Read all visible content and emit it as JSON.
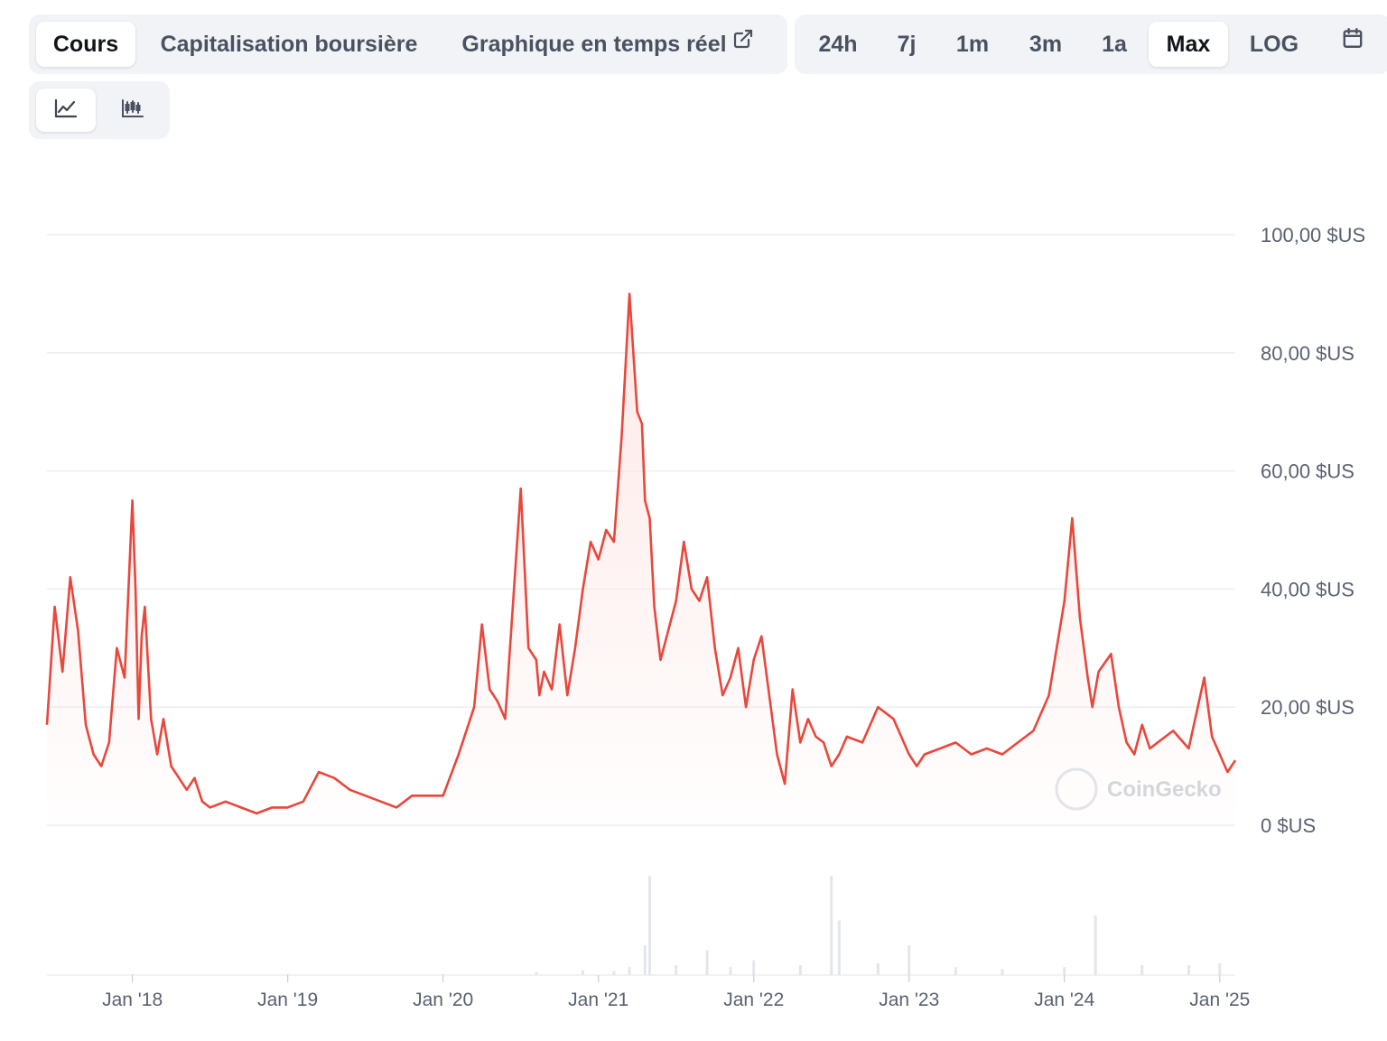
{
  "tabs": [
    {
      "label": "Cours",
      "active": true
    },
    {
      "label": "Capitalisation boursière",
      "active": false
    },
    {
      "label": "Graphique en temps réel",
      "active": false,
      "icon": "external-link-icon"
    }
  ],
  "ranges": [
    {
      "label": "24h",
      "active": false
    },
    {
      "label": "7j",
      "active": false
    },
    {
      "label": "1m",
      "active": false
    },
    {
      "label": "3m",
      "active": false
    },
    {
      "label": "1a",
      "active": false
    },
    {
      "label": "Max",
      "active": true
    },
    {
      "label": "LOG",
      "active": false
    }
  ],
  "calendar_icon": "calendar-icon",
  "chart_types": [
    {
      "icon": "line-chart-icon",
      "active": true
    },
    {
      "icon": "candlestick-chart-icon",
      "active": false
    }
  ],
  "watermark": "CoinGecko",
  "colors": {
    "line": "#e8473c",
    "fill": "#fde6e4",
    "grid": "#e9ebee",
    "volume": "#e3e6ea"
  },
  "chart_data": {
    "type": "area",
    "x_unit": "year",
    "x": [
      2017.45,
      2017.5,
      2017.55,
      2017.6,
      2017.65,
      2017.7,
      2017.75,
      2017.8,
      2017.85,
      2017.9,
      2017.95,
      2018.0,
      2018.02,
      2018.04,
      2018.06,
      2018.08,
      2018.12,
      2018.16,
      2018.2,
      2018.25,
      2018.3,
      2018.35,
      2018.4,
      2018.45,
      2018.5,
      2018.6,
      2018.7,
      2018.8,
      2018.9,
      2019.0,
      2019.1,
      2019.2,
      2019.3,
      2019.4,
      2019.5,
      2019.6,
      2019.7,
      2019.8,
      2019.9,
      2020.0,
      2020.1,
      2020.2,
      2020.25,
      2020.3,
      2020.35,
      2020.4,
      2020.5,
      2020.55,
      2020.6,
      2020.62,
      2020.65,
      2020.7,
      2020.75,
      2020.8,
      2020.85,
      2020.9,
      2020.95,
      2021.0,
      2021.05,
      2021.1,
      2021.15,
      2021.2,
      2021.25,
      2021.28,
      2021.3,
      2021.33,
      2021.36,
      2021.4,
      2021.45,
      2021.5,
      2021.55,
      2021.6,
      2021.65,
      2021.7,
      2021.75,
      2021.8,
      2021.85,
      2021.9,
      2021.95,
      2022.0,
      2022.05,
      2022.1,
      2022.15,
      2022.2,
      2022.25,
      2022.3,
      2022.35,
      2022.4,
      2022.45,
      2022.5,
      2022.55,
      2022.6,
      2022.7,
      2022.8,
      2022.9,
      2023.0,
      2023.05,
      2023.1,
      2023.2,
      2023.3,
      2023.4,
      2023.5,
      2023.6,
      2023.7,
      2023.8,
      2023.9,
      2024.0,
      2024.05,
      2024.1,
      2024.15,
      2024.18,
      2024.22,
      2024.3,
      2024.35,
      2024.4,
      2024.45,
      2024.5,
      2024.55,
      2024.6,
      2024.7,
      2024.8,
      2024.9,
      2024.95,
      2025.0,
      2025.05,
      2025.1
    ],
    "values": [
      17,
      37,
      26,
      42,
      33,
      17,
      12,
      10,
      14,
      30,
      25,
      55,
      40,
      18,
      32,
      37,
      18,
      12,
      18,
      10,
      8,
      6,
      8,
      4,
      3,
      4,
      3,
      2,
      3,
      3,
      4,
      9,
      8,
      6,
      5,
      4,
      3,
      5,
      5,
      5,
      12,
      20,
      34,
      23,
      21,
      18,
      57,
      30,
      28,
      22,
      26,
      23,
      34,
      22,
      30,
      40,
      48,
      45,
      50,
      48,
      66,
      90,
      70,
      68,
      55,
      52,
      37,
      28,
      33,
      38,
      48,
      40,
      38,
      42,
      30,
      22,
      25,
      30,
      20,
      28,
      32,
      22,
      12,
      7,
      23,
      14,
      18,
      15,
      14,
      10,
      12,
      15,
      14,
      20,
      18,
      12,
      10,
      12,
      13,
      14,
      12,
      13,
      12,
      14,
      16,
      22,
      38,
      52,
      35,
      25,
      20,
      26,
      29,
      20,
      14,
      12,
      17,
      13,
      14,
      16,
      13,
      25,
      15,
      12,
      9,
      11
    ],
    "yticks": [
      "100,00 $US",
      "80,00 $US",
      "60,00 $US",
      "40,00 $US",
      "20,00 $US",
      "0 $US"
    ],
    "ytick_values": [
      100,
      80,
      60,
      40,
      20,
      0
    ],
    "xticks": [
      "Jan '18",
      "Jan '19",
      "Jan '20",
      "Jan '21",
      "Jan '22",
      "Jan '23",
      "Jan '24",
      "Jan '25"
    ],
    "xtick_values": [
      2018,
      2019,
      2020,
      2021,
      2022,
      2023,
      2024,
      2025
    ],
    "xlim": [
      2017.45,
      2025.1
    ],
    "ylim": [
      0,
      100
    ],
    "grid": true,
    "volume": {
      "x": [
        2018.0,
        2019.0,
        2020.0,
        2020.6,
        2020.9,
        2021.1,
        2021.2,
        2021.3,
        2021.33,
        2021.5,
        2021.7,
        2021.85,
        2022.0,
        2022.3,
        2022.5,
        2022.55,
        2022.8,
        2023.0,
        2023.3,
        2023.6,
        2024.0,
        2024.2,
        2024.5,
        2024.8,
        2025.0
      ],
      "values": [
        1,
        1,
        1,
        3,
        5,
        4,
        8,
        30,
        100,
        10,
        25,
        8,
        15,
        10,
        100,
        55,
        12,
        30,
        8,
        6,
        8,
        60,
        10,
        10,
        12
      ]
    }
  }
}
